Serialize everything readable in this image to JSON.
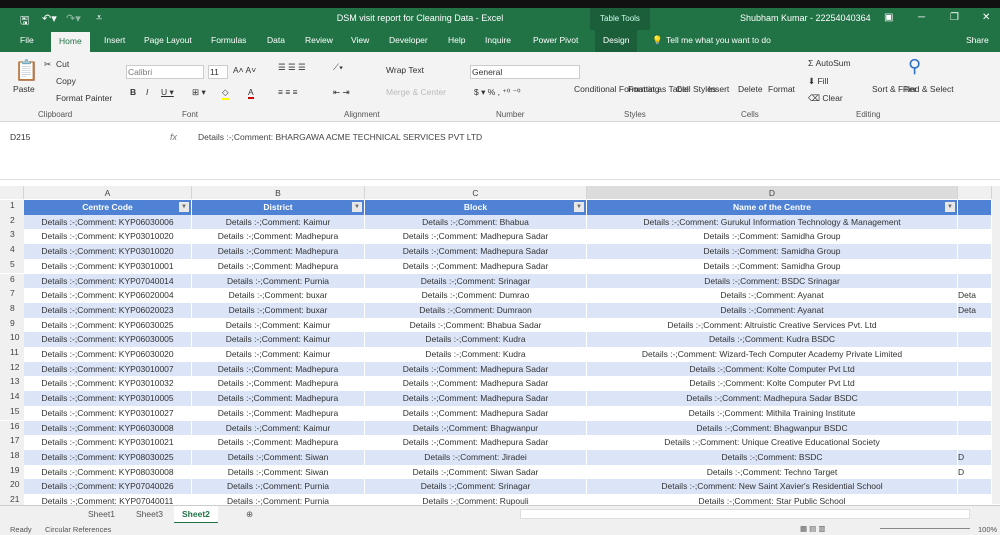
{
  "window": {
    "title": "DSM visit report for Cleaning Data  -  Excel",
    "context_tab": "Table Tools",
    "user": "Shubham Kumar - 22254040364"
  },
  "tabs": [
    "File",
    "Home",
    "Insert",
    "Page Layout",
    "Formulas",
    "Data",
    "Review",
    "View",
    "Developer",
    "Help",
    "Inquire",
    "Power Pivot",
    "Design"
  ],
  "tell_me": "Tell me what you want to do",
  "share": "Share",
  "ribbon": {
    "paste": "Paste",
    "cut": "Cut",
    "copy": "Copy",
    "format_painter": "Format Painter",
    "font": "Calibri",
    "size": "11",
    "wrap": "Wrap Text",
    "merge": "Merge & Center",
    "number_format": "General",
    "cond": "Conditional Formatting",
    "fmt_table": "Format as Table",
    "cell_styles": "Cell Styles",
    "insert": "Insert",
    "delete": "Delete",
    "format": "Format",
    "autosum": "AutoSum",
    "fill": "Fill",
    "clear": "Clear",
    "sort": "Sort & Filter",
    "find": "Find & Select",
    "groups": [
      "Clipboard",
      "Font",
      "Alignment",
      "Number",
      "Styles",
      "Cells",
      "Editing"
    ]
  },
  "name_box": "D215",
  "formula": "Details :-;Comment: BHARGAWA ACME TECHNICAL SERVICES PVT LTD",
  "columns": [
    "A",
    "B",
    "C",
    "D"
  ],
  "headers": [
    "Centre Code",
    "District",
    "Block",
    "Name of the Centre"
  ],
  "rows": [
    [
      "2",
      "Details :-;Comment: KYP06030006",
      "Details :-;Comment: Kaimur",
      "Details :-;Comment: Bhabua",
      "Details :-;Comment: Gurukul Information Technology & Management",
      ""
    ],
    [
      "3",
      "Details :-;Comment: KYP03010020",
      "Details :-;Comment: Madhepura",
      "Details :-;Comment: Madhepura Sadar",
      "Details :-;Comment: Samidha Group",
      ""
    ],
    [
      "4",
      "Details :-;Comment: KYP03010020",
      "Details :-;Comment: Madhepura",
      "Details :-;Comment: Madhepura Sadar",
      "Details :-;Comment: Samidha Group",
      ""
    ],
    [
      "5",
      "Details :-;Comment: KYP03010001",
      "Details :-;Comment: Madhepura",
      "Details :-;Comment: Madhepura Sadar",
      "Details :-;Comment: Samidha Group",
      ""
    ],
    [
      "6",
      "Details :-;Comment: KYP07040014",
      "Details :-;Comment: Purnia",
      "Details :-;Comment: Srinagar",
      "Details :-;Comment: BSDC Srinagar",
      ""
    ],
    [
      "7",
      "Details :-;Comment: KYP06020004",
      "Details :-;Comment: buxar",
      "Details :-;Comment: Dumrao",
      "Details :-;Comment: Ayanat",
      "Deta"
    ],
    [
      "8",
      "Details :-;Comment: KYP06020023",
      "Details :-;Comment: buxar",
      "Details :-;Comment: Dumraon",
      "Details :-;Comment: Ayanat",
      "Deta"
    ],
    [
      "9",
      "Details :-;Comment: KYP06030025",
      "Details :-;Comment: Kaimur",
      "Details :-;Comment: Bhabua Sadar",
      "Details :-;Comment: Altruistic Creative Services Pvt. Ltd",
      ""
    ],
    [
      "10",
      "Details :-;Comment: KYP06030005",
      "Details :-;Comment: Kaimur",
      "Details :-;Comment: Kudra",
      "Details :-;Comment: Kudra BSDC",
      ""
    ],
    [
      "11",
      "Details :-;Comment: KYP06030020",
      "Details :-;Comment: Kaimur",
      "Details :-;Comment: Kudra",
      "Details :-;Comment: Wizard-Tech Computer Academy Private Limited",
      ""
    ],
    [
      "12",
      "Details :-;Comment: KYP03010007",
      "Details :-;Comment: Madhepura",
      "Details :-;Comment: Madhepura Sadar",
      "Details :-;Comment: Kolte Computer Pvt Ltd",
      ""
    ],
    [
      "13",
      "Details :-;Comment: KYP03010032",
      "Details :-;Comment: Madhepura",
      "Details :-;Comment: Madhepura Sadar",
      "Details :-;Comment: Kolte Computer Pvt Ltd",
      ""
    ],
    [
      "14",
      "Details :-;Comment: KYP03010005",
      "Details :-;Comment: Madhepura",
      "Details :-;Comment: Madhepura Sadar",
      "Details :-;Comment: Madhepura Sadar BSDC",
      ""
    ],
    [
      "15",
      "Details :-;Comment: KYP03010027",
      "Details :-;Comment: Madhepura",
      "Details :-;Comment: Madhepura Sadar",
      "Details :-;Comment: Mithila Training Institute",
      ""
    ],
    [
      "16",
      "Details :-;Comment: KYP06030008",
      "Details :-;Comment: Kaimur",
      "Details :-;Comment: Bhagwanpur",
      "Details :-;Comment: Bhagwanpur BSDC",
      ""
    ],
    [
      "17",
      "Details :-;Comment: KYP03010021",
      "Details :-;Comment: Madhepura",
      "Details :-;Comment: Madhepura Sadar",
      "Details :-;Comment: Unique Creative Educational Society",
      ""
    ],
    [
      "18",
      "Details :-;Comment: KYP08030025",
      "Details :-;Comment: Siwan",
      "Details :-;Comment: Jiradei",
      "Details :-;Comment: BSDC",
      "D"
    ],
    [
      "19",
      "Details :-;Comment: KYP08030008",
      "Details :-;Comment: Siwan",
      "Details :-;Comment: Siwan Sadar",
      "Details :-;Comment: Techno Target",
      "D"
    ],
    [
      "20",
      "Details :-;Comment: KYP07040026",
      "Details :-;Comment: Purnia",
      "Details :-;Comment: Srinagar",
      "Details :-;Comment: New Saint Xavier's Residential School",
      ""
    ],
    [
      "21",
      "Details :-;Comment: KYP07040011",
      "Details :-;Comment: Purnia",
      "Details :-;Comment: Rupouli",
      "Details :-;Comment: Star Public School",
      ""
    ]
  ],
  "sheets": [
    "Sheet1",
    "Sheet3",
    "Sheet2"
  ],
  "status": {
    "ready": "Ready",
    "circular": "Circular References",
    "zoom": "100%"
  }
}
